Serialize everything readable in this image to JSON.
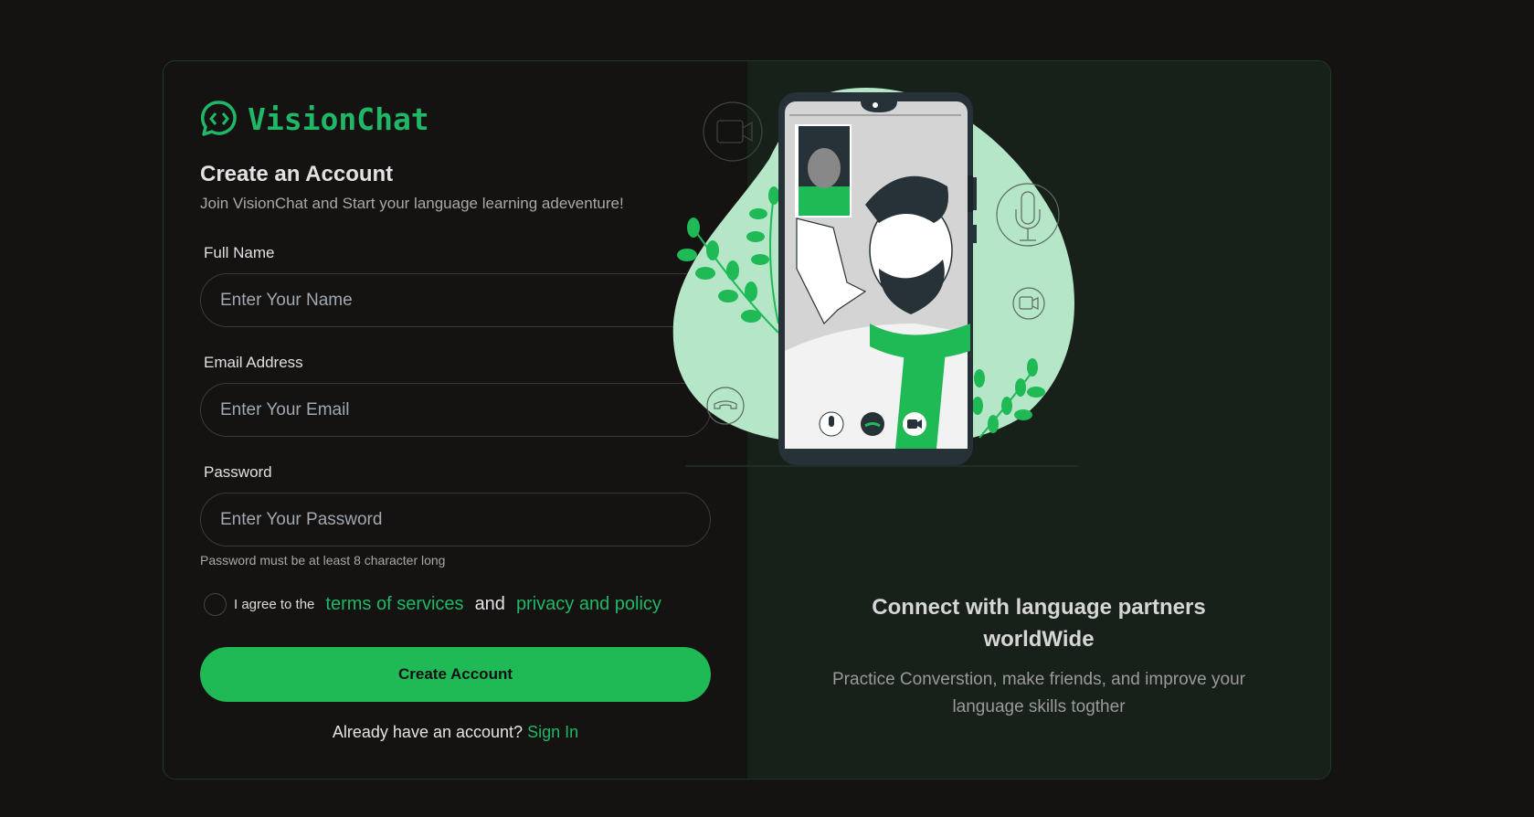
{
  "brand": {
    "name": "VisionChat",
    "accent": "#1fb866"
  },
  "form": {
    "title": "Create an Account",
    "subtitle": "Join VisionChat and Start your language learning adeventure!",
    "full_name": {
      "label": "Full Name",
      "placeholder": "Enter Your Name"
    },
    "email": {
      "label": "Email Address",
      "placeholder": "Enter Your Email"
    },
    "password": {
      "label": "Password",
      "placeholder": "Enter Your Password",
      "hint": "Password must be at least 8 character long"
    },
    "agree": {
      "prefix": "I agree to the",
      "terms": "terms of services",
      "and": "and",
      "privacy": "privacy and policy"
    },
    "submit": "Create Account",
    "signin_prompt": "Already have an account?",
    "signin_link": "Sign In"
  },
  "promo": {
    "heading": "Connect with language partners worldWide",
    "text": "Practice Converstion, make friends, and improve your language skills togther"
  }
}
